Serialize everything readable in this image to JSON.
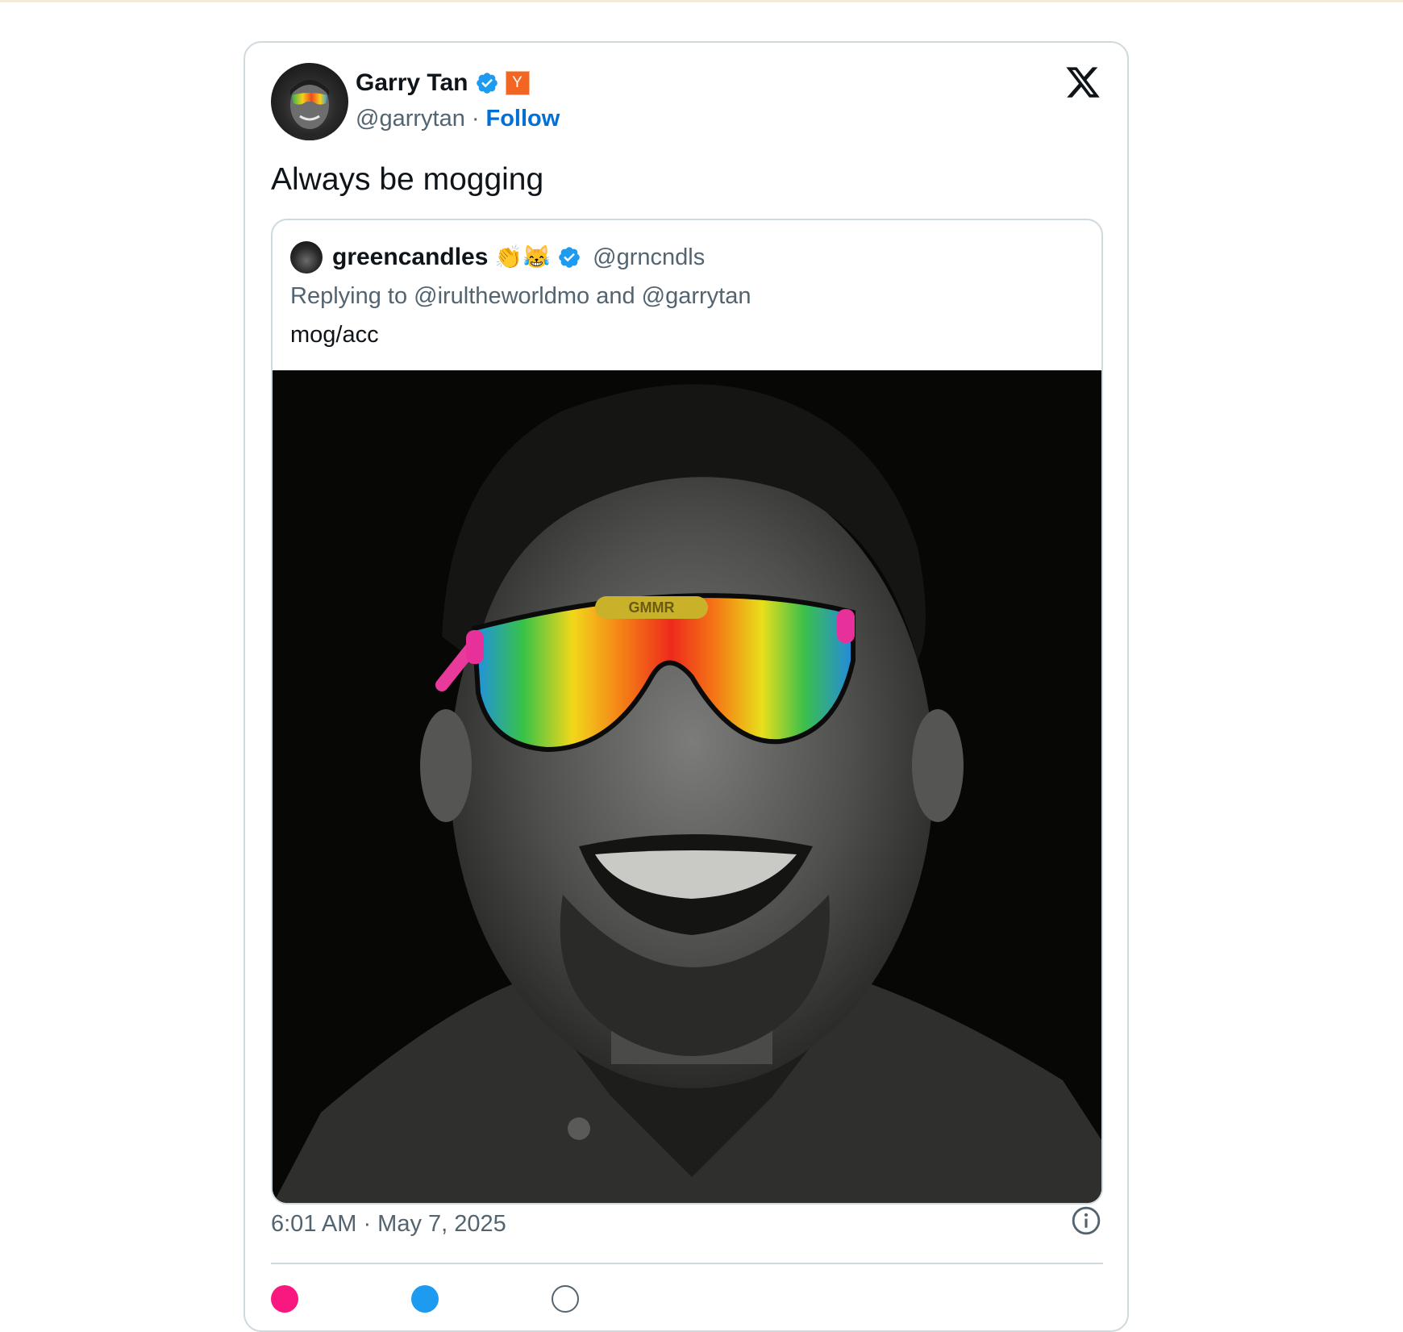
{
  "tweet": {
    "author": {
      "name": "Garry Tan",
      "handle": "@garrytan",
      "follow_label": "Follow",
      "badge_letter": "Y"
    },
    "text": "Always be mogging",
    "timestamp": "6:01 AM · May 7, 2025",
    "separator": "·"
  },
  "quote": {
    "author": {
      "name": "greencandles",
      "emoji": "👏😹",
      "handle": "@grncndls"
    },
    "reply_to": "Replying to @irultheworldmo and @garrytan",
    "text": "mog/acc",
    "media_label": "GMMR"
  },
  "colors": {
    "verified": "#1d9bf0",
    "follow": "#006fd6",
    "yc": "#f26522",
    "border": "#cfd9de"
  }
}
